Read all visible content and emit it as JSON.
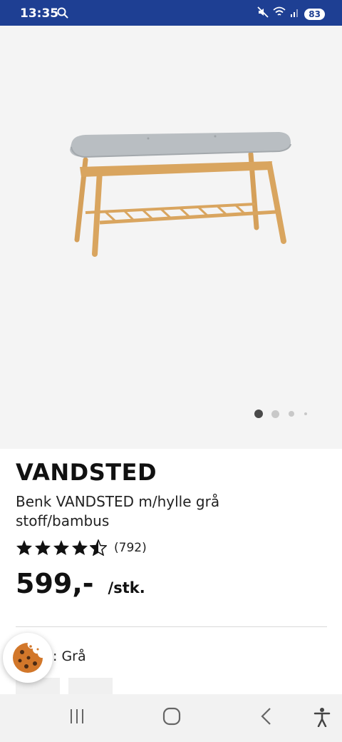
{
  "status_bar": {
    "time": "13:35",
    "battery": "83"
  },
  "image_carousel": {
    "dot_count": 4,
    "active_index": 0
  },
  "product": {
    "name": "VANDSTED",
    "description": "Benk VANDSTED m/hylle grå stoff/bambus",
    "rating": 4.5,
    "review_count": "(792)",
    "price": "599,-",
    "price_unit": "/stk.",
    "color_label": ": Grå"
  },
  "icons": {
    "search": "search-icon",
    "mute": "mute-icon",
    "wifi": "wifi-icon",
    "signal": "signal-icon",
    "cookie": "cookie-icon",
    "recent_apps": "recent-apps-icon",
    "home": "home-icon",
    "back": "back-icon",
    "accessibility": "accessibility-icon"
  },
  "colors": {
    "status_bar": "#1e3f93",
    "image_background": "#f4f4f4",
    "seat_fabric": "#b7bcc0",
    "bamboo": "#d9a55f",
    "cookie": "#d2772a"
  }
}
